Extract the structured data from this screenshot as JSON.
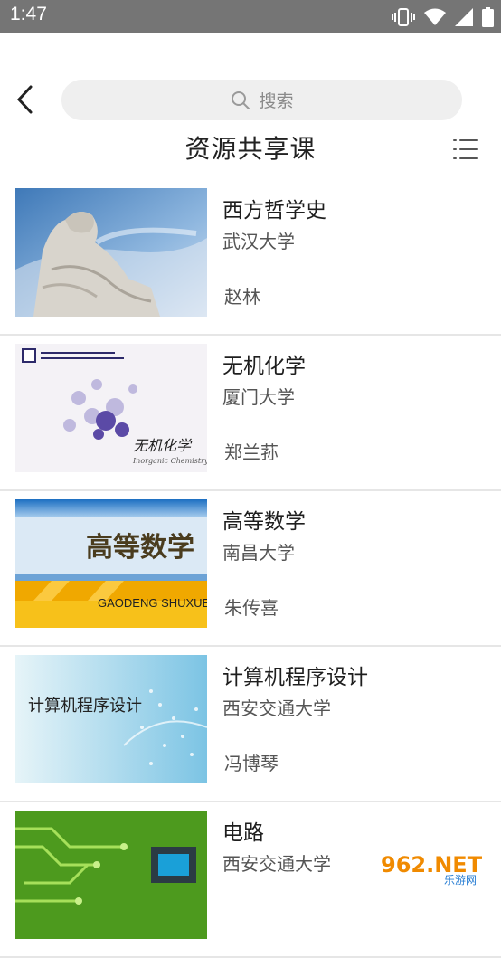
{
  "status_bar": {
    "time": "1:47"
  },
  "search": {
    "placeholder": "搜索"
  },
  "page": {
    "title": "资源共享课"
  },
  "courses": [
    {
      "title": "西方哲学史",
      "school": "武汉大学",
      "teacher": "赵林",
      "thumb": "statue-thinker"
    },
    {
      "title": "无机化学",
      "school": "厦门大学",
      "teacher": "郑兰荪",
      "thumb": "molecules",
      "thumb_text": "无机化学",
      "thumb_sub": "Inorganic Chemistry"
    },
    {
      "title": "高等数学",
      "school": "南昌大学",
      "teacher": "朱传喜",
      "thumb": "banner-math",
      "thumb_text": "高等数学",
      "thumb_sub": "GAODENG SHUXUE"
    },
    {
      "title": "计算机程序设计",
      "school": "西安交通大学",
      "teacher": "冯博琴",
      "thumb": "circuit-blue",
      "thumb_text": "计算机程序设计"
    },
    {
      "title": "电路",
      "school": "西安交通大学",
      "teacher": "",
      "thumb": "pcb-green"
    }
  ],
  "watermark": {
    "text": "962.NET",
    "sub": "乐游网"
  },
  "colors": {
    "status_bar": "#757575",
    "search_bg": "#efefef",
    "divider": "#e6e6e6"
  }
}
